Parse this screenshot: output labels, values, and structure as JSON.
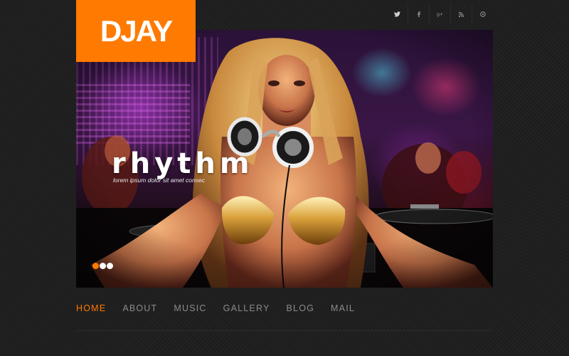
{
  "logo": {
    "text": "DJAY"
  },
  "social": [
    {
      "icon": "twitter-icon"
    },
    {
      "icon": "facebook-icon"
    },
    {
      "icon": "google-plus-icon"
    },
    {
      "icon": "rss-icon"
    },
    {
      "icon": "dribbble-icon"
    }
  ],
  "slider": {
    "title": "rhythm",
    "subtitle": "lorem ipsum dolor sit amet consec",
    "slide_count": 3,
    "active_slide": 1
  },
  "nav": {
    "items": [
      {
        "label": "HOME",
        "active": true
      },
      {
        "label": "ABOUT",
        "active": false
      },
      {
        "label": "MUSIC",
        "active": false
      },
      {
        "label": "GALLERY",
        "active": false
      },
      {
        "label": "BLOG",
        "active": false
      },
      {
        "label": "MAIL",
        "active": false
      }
    ]
  },
  "colors": {
    "accent": "#ff7a00",
    "background": "#1f1f1f",
    "nav_text": "#8a8a8a"
  }
}
